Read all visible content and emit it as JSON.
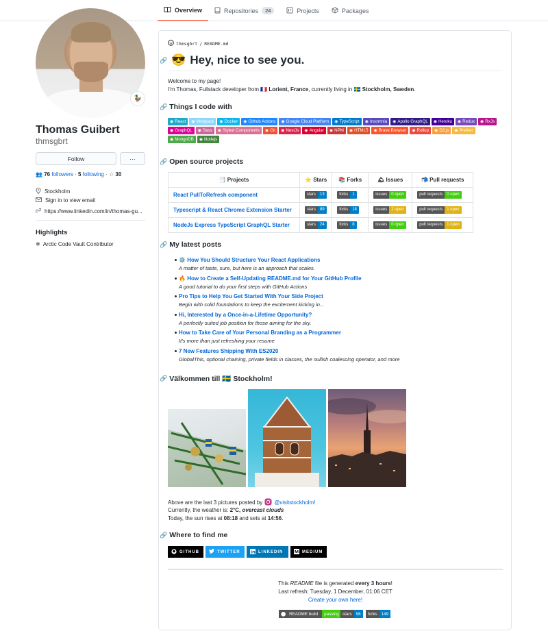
{
  "nav": {
    "tabs": [
      {
        "label": "Overview",
        "icon": "book-icon"
      },
      {
        "label": "Repositories",
        "count": "24",
        "icon": "repo-icon"
      },
      {
        "label": "Projects",
        "icon": "project-icon"
      },
      {
        "label": "Packages",
        "icon": "package-icon"
      }
    ]
  },
  "profile": {
    "name": "Thomas Guibert",
    "login": "thmsgbrt",
    "status_emoji": "🦆",
    "follow_label": "Follow",
    "more_label": "···",
    "followers_count": "76",
    "followers_label": "followers",
    "following_count": "5",
    "following_label": "following",
    "stars_count": "30",
    "location": "Stockholm",
    "email": "Sign in to view email",
    "website": "https://www.linkedin.com/in/thomas-gu...",
    "highlights_title": "Highlights",
    "highlight_item": "Arctic Code Vault Contributor"
  },
  "readme": {
    "path_user": "thmsgbrt",
    "path_sep": "/",
    "path_file": "README.md",
    "title_emoji": "😎",
    "title": "Hey, nice to see you.",
    "welcome": "Welcome to my page!",
    "intro_pre": "I'm Thomas, Fullstack developer from ",
    "intro_place1": "Lorient, France",
    "intro_mid": ", currently living in ",
    "intro_place2": "Stockholm, Sweden",
    "intro_end": ".",
    "code_title": "Things I code with",
    "badges": [
      {
        "label": "React",
        "color": "#20a8c7"
      },
      {
        "label": "Webpack",
        "color": "#8ed6fb"
      },
      {
        "label": "Docker",
        "color": "#0db7ed"
      },
      {
        "label": "Github Actions",
        "color": "#2088ff"
      },
      {
        "label": "Google Cloud Platform",
        "color": "#4285f4"
      },
      {
        "label": "TypeScript",
        "color": "#007acc"
      },
      {
        "label": "Insomnia",
        "color": "#5849be"
      },
      {
        "label": "Apollo GraphQL",
        "color": "#311c87"
      },
      {
        "label": "Heroku",
        "color": "#430098"
      },
      {
        "label": "Redux",
        "color": "#764abc"
      },
      {
        "label": "RxJs",
        "color": "#b7178c"
      },
      {
        "label": "GraphQL",
        "color": "#e10098"
      },
      {
        "label": "Sass",
        "color": "#cc6699"
      },
      {
        "label": "Styled Components",
        "color": "#db7093"
      },
      {
        "label": "Git",
        "color": "#f05033"
      },
      {
        "label": "NestJs",
        "color": "#e0234e"
      },
      {
        "label": "Angular",
        "color": "#dd0031"
      },
      {
        "label": "NPM",
        "color": "#cb3837"
      },
      {
        "label": "HTML5",
        "color": "#e34f26"
      },
      {
        "label": "Brave Browser",
        "color": "#fb542b"
      },
      {
        "label": "Rollup",
        "color": "#ec4a3f"
      },
      {
        "label": "D3.js",
        "color": "#f9a03c"
      },
      {
        "label": "Prettier",
        "color": "#f7b93e"
      },
      {
        "label": "MongoDB",
        "color": "#4ea94b"
      },
      {
        "label": "Nodejs",
        "color": "#43853d"
      }
    ],
    "oss_title": "Open source projects",
    "table_headers": [
      "Projects",
      "Stars",
      "Forks",
      "Issues",
      "Pull requests"
    ],
    "projects": [
      {
        "name": "React PullToRefresh component",
        "stars": "13",
        "forks": "1",
        "issues": "0 open",
        "issues_color": "#4c1",
        "prs": "0 open",
        "prs_color": "#4c1"
      },
      {
        "name": "Typescript & React Chrome Extension Starter",
        "stars": "89",
        "forks": "18",
        "issues": "2 open",
        "issues_color": "#dfb317",
        "prs": "1 open",
        "prs_color": "#dfb317"
      },
      {
        "name": "NodeJs Express TypeScript GraphQL Starter",
        "stars": "24",
        "forks": "8",
        "issues": "0 open",
        "issues_color": "#4c1",
        "prs": "1 open",
        "prs_color": "#dfb317"
      }
    ],
    "shield_labels": {
      "stars": "stars",
      "forks": "forks",
      "issues": "issues",
      "prs": "pull requests"
    },
    "posts_title": "My latest posts",
    "posts": [
      {
        "emoji": "⚙️",
        "title": "How You Should Structure Your React Applications",
        "desc": "A matter of taste, sure, but here is an approach that scales."
      },
      {
        "emoji": "🔥",
        "title": "How to Create a Self-Updating README.md for Your GitHub Profile",
        "desc": "A good tutorial to do your first steps with GitHub Actions"
      },
      {
        "emoji": "",
        "title": "Pro Tips to Help You Get Started With Your Side Project",
        "desc": "Begin with solid foundations to keep the excitement kicking in..."
      },
      {
        "emoji": "",
        "title": "Hi, Interested by a Once-in-a-Lifetime Opportunity?",
        "desc": "A perfectly suited job position for those aiming for the sky."
      },
      {
        "emoji": "",
        "title": "How to Take Care of Your Personal Branding as a Programmer",
        "desc": "It's more than just refreshing your resume"
      },
      {
        "emoji": "",
        "title": "7 New Features Shipping With ES2020",
        "desc": "GlobalThis, optional chaining, private fields in classes, the nullish coalescing operator, and more"
      }
    ],
    "stockholm_title_pre": "Välkommen till",
    "stockholm_title_post": "Stockholm!",
    "photos_caption_pre": "Above are the last 3 pictures posted by",
    "photos_handle": "@visitstockholm!",
    "weather_pre": "Currently, the weather is: ",
    "weather_temp": "2°C,",
    "weather_desc": "overcast clouds",
    "sun_pre": "Today, the sun rises at ",
    "sunrise": "08:18",
    "sun_mid": " and sets at ",
    "sunset": "14:56",
    "sun_end": ".",
    "find_title": "Where to find me",
    "social": [
      {
        "label": "GITHUB",
        "color": "#000000"
      },
      {
        "label": "TWITTER",
        "color": "#1da1f2"
      },
      {
        "label": "LINKEDIN",
        "color": "#0077b5"
      },
      {
        "label": "MEDIUM",
        "color": "#000000"
      }
    ],
    "footer_pre": "This ",
    "footer_readme": "README",
    "footer_mid": " file is generated ",
    "footer_freq": "every 3 hours",
    "footer_end": "!",
    "last_refresh": "Last refresh: Tuesday, 1 December, 01:06 CET",
    "create_link": "Create your own here!",
    "build_label": "README build",
    "build_value": "passing",
    "footer_stars": "96",
    "footer_forks": "149"
  },
  "colors": {
    "accent": "#0366d6",
    "tab_underline": "#f9826c"
  }
}
